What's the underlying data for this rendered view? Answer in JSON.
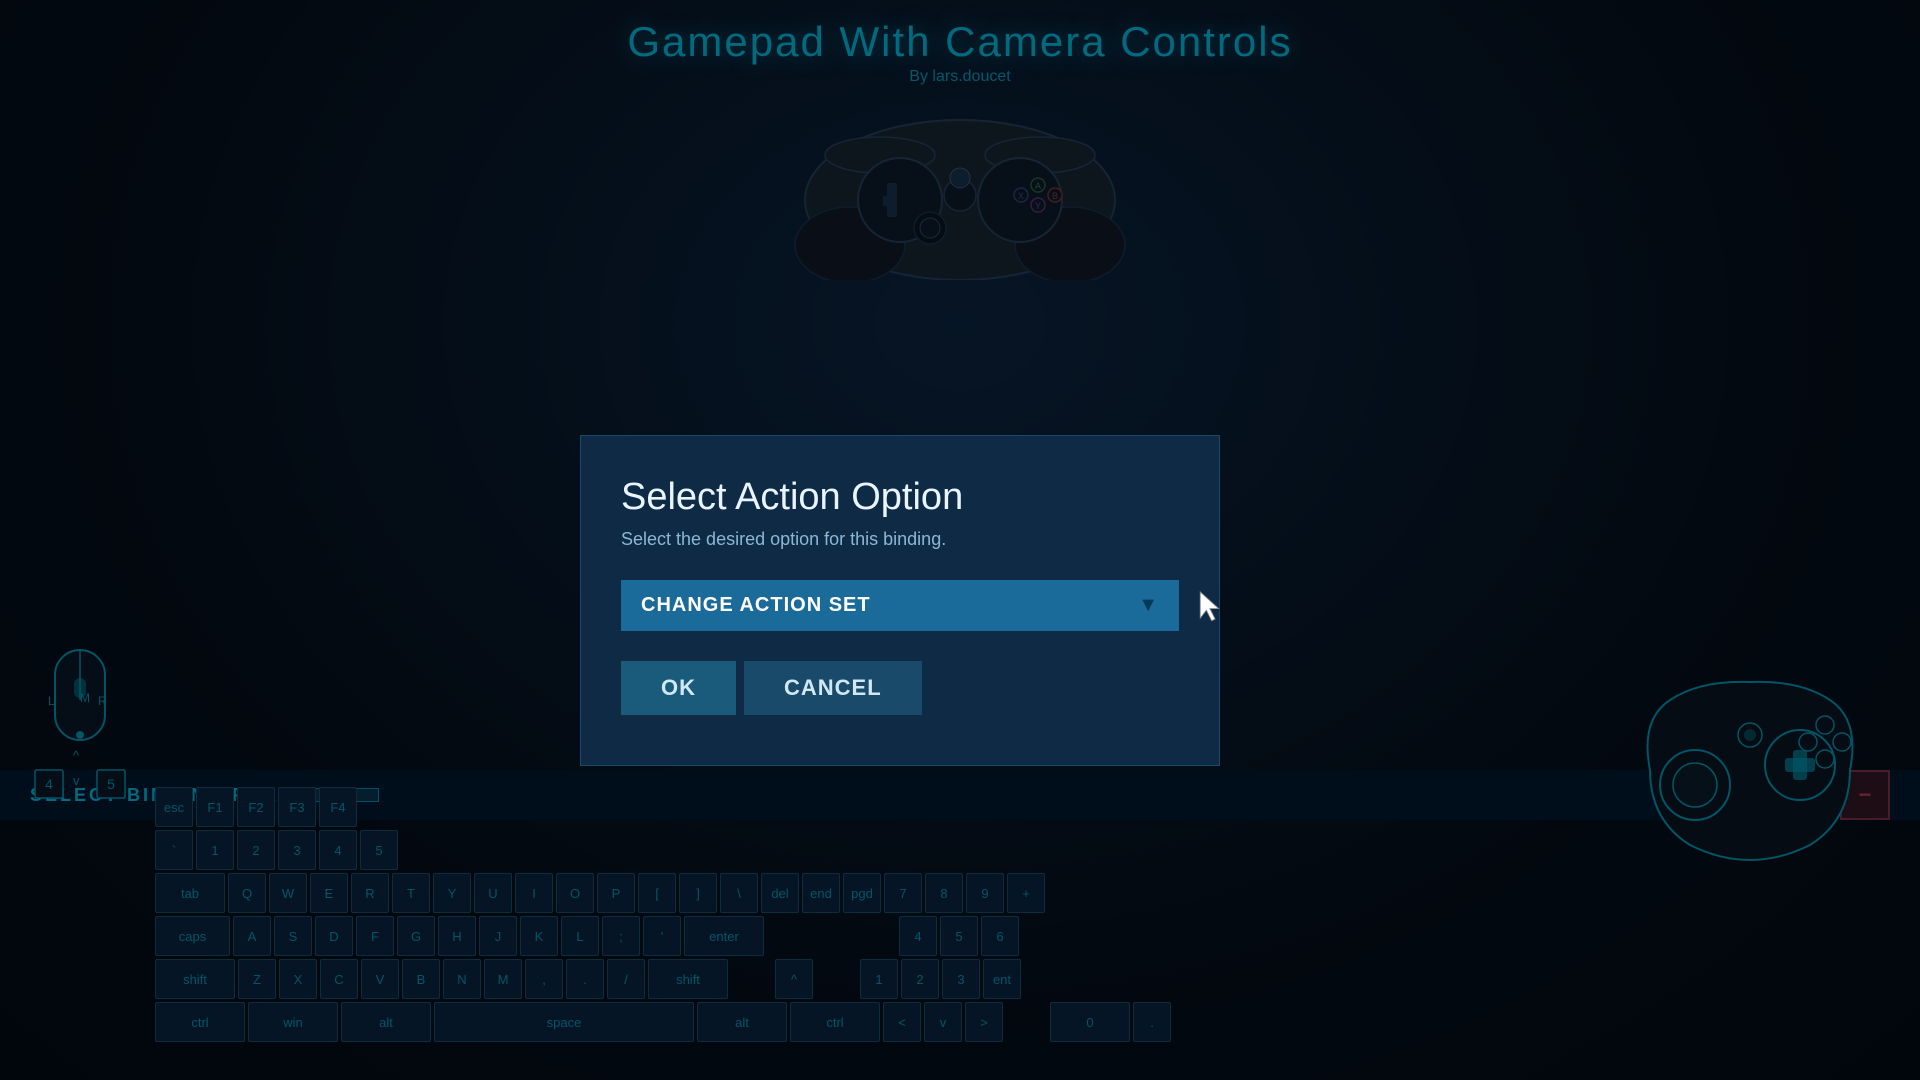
{
  "page": {
    "title": "Gamepad With Camera Controls",
    "subtitle": "By lars.doucet"
  },
  "modal": {
    "title": "Select Action Option",
    "description": "Select the desired option for this binding.",
    "dropdown_label": "CHANGE ACTION SET",
    "ok_label": "OK",
    "cancel_label": "CANCEL"
  },
  "binding": {
    "label": "SELECT BINDING FOR"
  },
  "keyboard": {
    "rows": [
      [
        "esc",
        "F1",
        "F2",
        "F3",
        "F4"
      ],
      [
        "`",
        "1",
        "2",
        "3",
        "4",
        "5"
      ],
      [
        "tab",
        "Q",
        "W",
        "E",
        "R",
        "T",
        "Y",
        "U",
        "I",
        "O",
        "P",
        "[",
        "]",
        "\\",
        "del",
        "end",
        "pgd",
        "7",
        "8",
        "9",
        "+"
      ],
      [
        "caps",
        "A",
        "S",
        "D",
        "F",
        "G",
        "H",
        "J",
        "K",
        "L",
        ";",
        "'",
        "enter",
        "",
        "",
        "",
        "4",
        "5",
        "6"
      ],
      [
        "shift",
        "Z",
        "X",
        "C",
        "V",
        "B",
        "N",
        "M",
        ",",
        ".",
        "/",
        "shift",
        "",
        "^",
        "",
        "1",
        "2",
        "3",
        "ent"
      ],
      [
        "ctrl",
        "win",
        "alt",
        "space",
        "alt",
        "ctrl",
        "<",
        "v",
        ">",
        "",
        "0",
        "."
      ]
    ]
  },
  "icons": {
    "music_note": "♪",
    "minus": "—",
    "cursor": "▶"
  }
}
